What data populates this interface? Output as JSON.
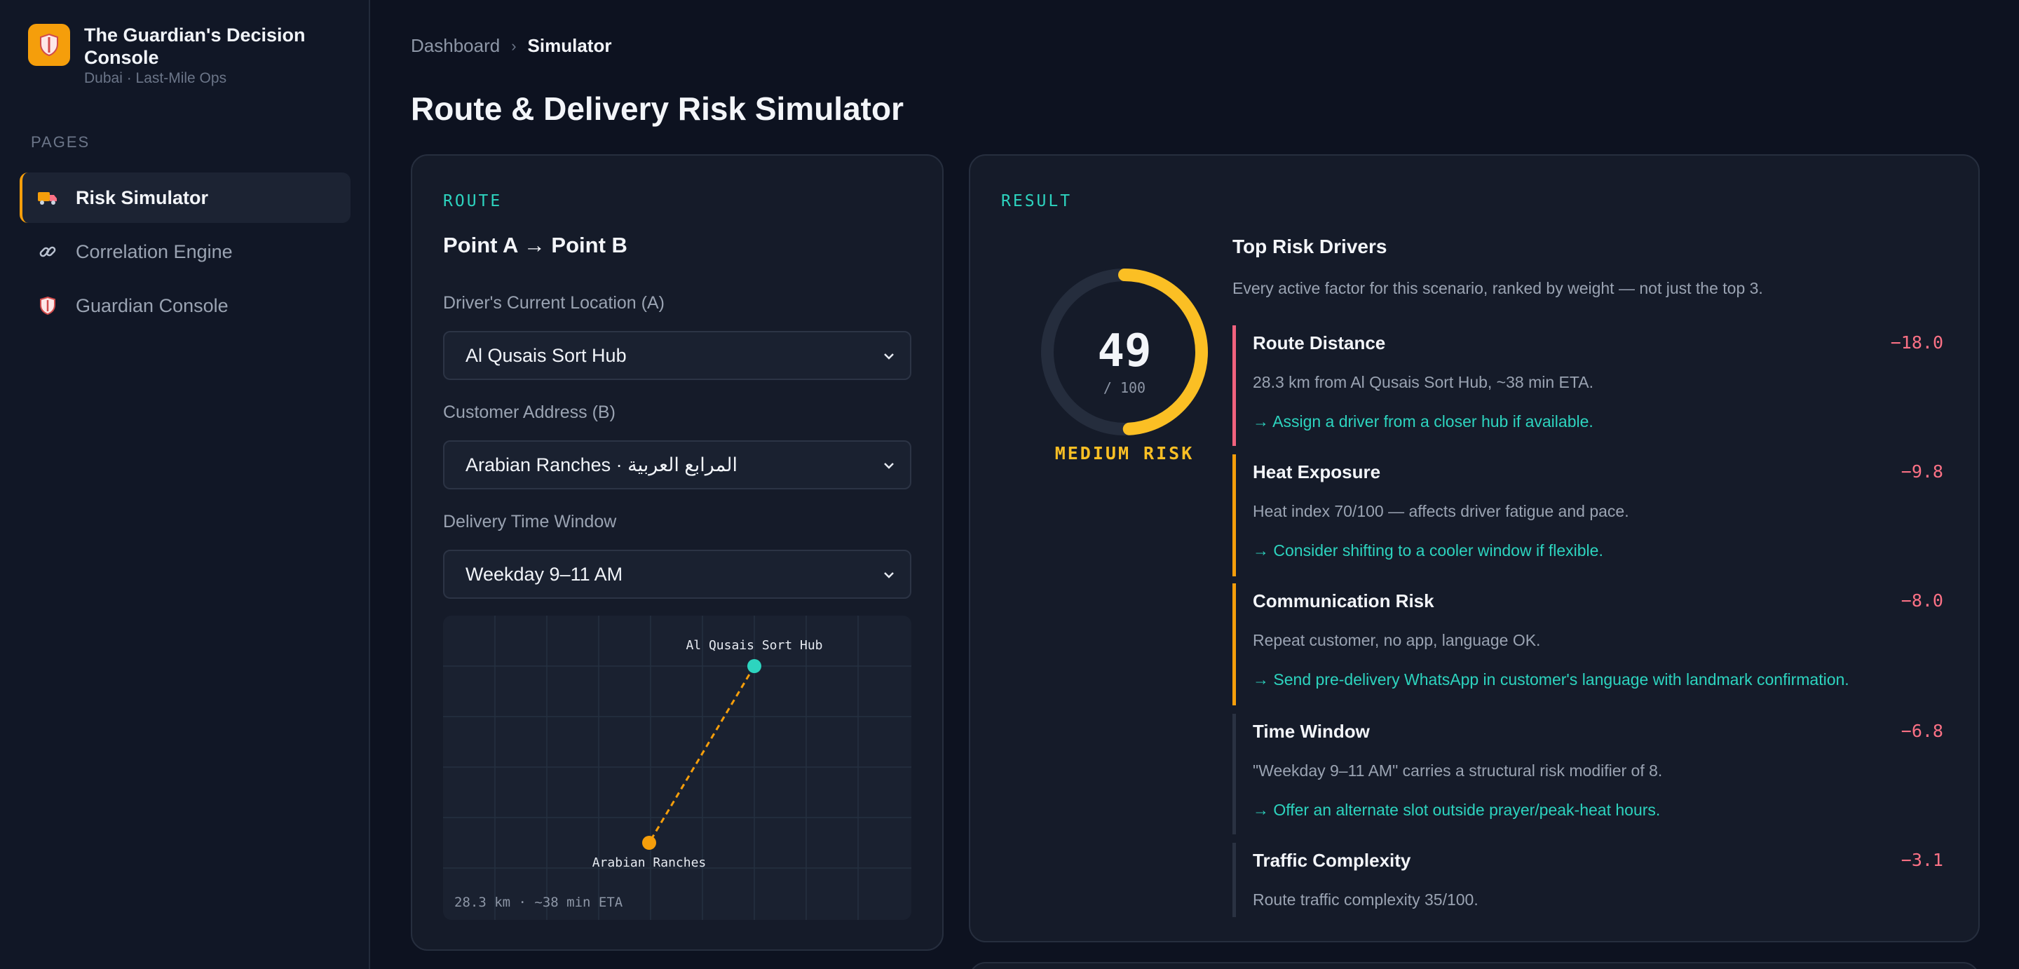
{
  "brand": {
    "title": "The Guardian's Decision Console",
    "subtitle": "Dubai · Last-Mile Ops",
    "logo_icon": "shield-icon"
  },
  "sidebar": {
    "section_label": "PAGES",
    "items": [
      {
        "label": "Risk Simulator",
        "icon": "truck-icon",
        "active": true
      },
      {
        "label": "Correlation Engine",
        "icon": "link-icon",
        "active": false
      },
      {
        "label": "Guardian Console",
        "icon": "shield-icon",
        "active": false
      }
    ]
  },
  "breadcrumb": {
    "parent": "Dashboard",
    "separator": "›",
    "current": "Simulator"
  },
  "page_title": "Route & Delivery Risk Simulator",
  "route": {
    "section_label": "ROUTE",
    "title": "Point A → Point B",
    "location_label": "Driver's Current Location (A)",
    "location_value": "Al Qusais Sort Hub",
    "address_label": "Customer Address (B)",
    "address_value": "Arabian Ranches · المرابع العربية",
    "window_label": "Delivery Time Window",
    "window_value": "Weekday 9–11 AM",
    "map": {
      "point_a_label": "Al Qusais Sort Hub",
      "point_b_label": "Arabian Ranches",
      "caption": "28.3 km · ~38 min ETA"
    }
  },
  "result": {
    "section_label": "RESULT",
    "score": "49",
    "score_max": "/ 100",
    "score_fraction": 0.49,
    "risk_level": "MEDIUM RISK",
    "drivers_title": "Top Risk Drivers",
    "drivers_subtitle": "Every active factor for this scenario, ranked by weight — not just the top 3.",
    "drivers": [
      {
        "name": "Route Distance",
        "score": "−18.0",
        "desc": "28.3 km from Al Qusais Sort Hub, ~38 min ETA.",
        "action": "→ Assign a driver from a closer hub if available.",
        "color": "#f0627e"
      },
      {
        "name": "Heat Exposure",
        "score": "−9.8",
        "desc": "Heat index 70/100 — affects driver fatigue and pace.",
        "action": "→ Consider shifting to a cooler window if flexible.",
        "color": "#f59e0b"
      },
      {
        "name": "Communication Risk",
        "score": "−8.0",
        "desc": "Repeat customer, no app, language OK.",
        "action": "→ Send pre-delivery WhatsApp in customer's language with landmark confirmation.",
        "color": "#f59e0b"
      },
      {
        "name": "Time Window",
        "score": "−6.8",
        "desc": "\"Weekday 9–11 AM\" carries a structural risk modifier of 8.",
        "action": "→ Offer an alternate slot outside prayer/peak-heat hours.",
        "color": "#2a3242"
      },
      {
        "name": "Traffic Complexity",
        "score": "−3.1",
        "desc": "Route traffic complexity 35/100.",
        "action": "",
        "color": "#2a3242"
      }
    ]
  }
}
